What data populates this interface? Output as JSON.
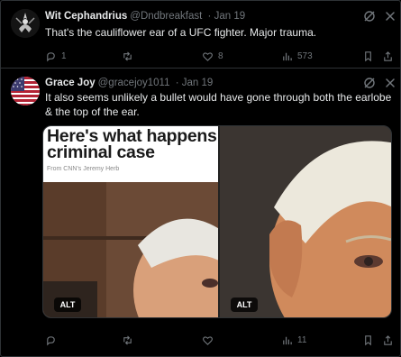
{
  "tweets": [
    {
      "author_name": "Wit Cephandrius",
      "handle": "@Dndbreakfast",
      "date": "Jan 19",
      "text": "That's the cauliflower ear of a UFC fighter. Major trauma.",
      "actions": {
        "replies": "1",
        "retweets": "",
        "likes": "8",
        "views": "573"
      }
    },
    {
      "author_name": "Grace Joy",
      "handle": "@gracejoy1011",
      "date": "Jan 19",
      "text": "It also seems unlikely a bullet would have gone through both the earlobe & the top of the ear.",
      "media": {
        "headline": "Here's what happens criminal case",
        "credit": "From CNN's Jeremy Herb",
        "alt_badges": [
          "ALT",
          "ALT"
        ]
      },
      "actions": {
        "replies": "",
        "retweets": "",
        "likes": "",
        "views": "11"
      }
    }
  ],
  "icons": {
    "grok": "grok-icon",
    "close": "close-icon",
    "reply": "reply-icon",
    "retweet": "retweet-icon",
    "like": "heart-icon",
    "views": "views-icon",
    "bookmark": "bookmark-icon",
    "share": "share-icon"
  },
  "colors": {
    "background": "#000000",
    "text": "#e7e9ea",
    "muted": "#71767b",
    "border": "#2f3336"
  }
}
